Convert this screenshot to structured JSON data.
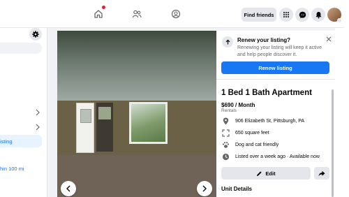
{
  "topbar": {
    "find_friends_label": "Find friends"
  },
  "sidebar": {
    "your_listing_label": "isting",
    "radius_label": "hin 100 mi"
  },
  "renew": {
    "title": "Renew your listing?",
    "text": "Renewing your listing will keep it active and help people discover it.",
    "button_label": "Renew listing"
  },
  "listing": {
    "title": "1 Bed 1 Bath Apartment",
    "price": "$690 / Month",
    "category": "Rentals",
    "details": [
      {
        "icon": "location-pin-icon",
        "text": "906 Elizabeth St, Pittsburgh, PA"
      },
      {
        "icon": "square-feet-icon",
        "text": "650 square feet"
      },
      {
        "icon": "paw-icon",
        "text": "Dog and cat friendly"
      },
      {
        "icon": "clock-icon",
        "text": "Listed over a week ago · Available now"
      }
    ],
    "edit_label": "Edit",
    "unit_details_label": "Unit Details"
  },
  "colors": {
    "accent": "#1877f2",
    "notification": "#e41e3f"
  }
}
